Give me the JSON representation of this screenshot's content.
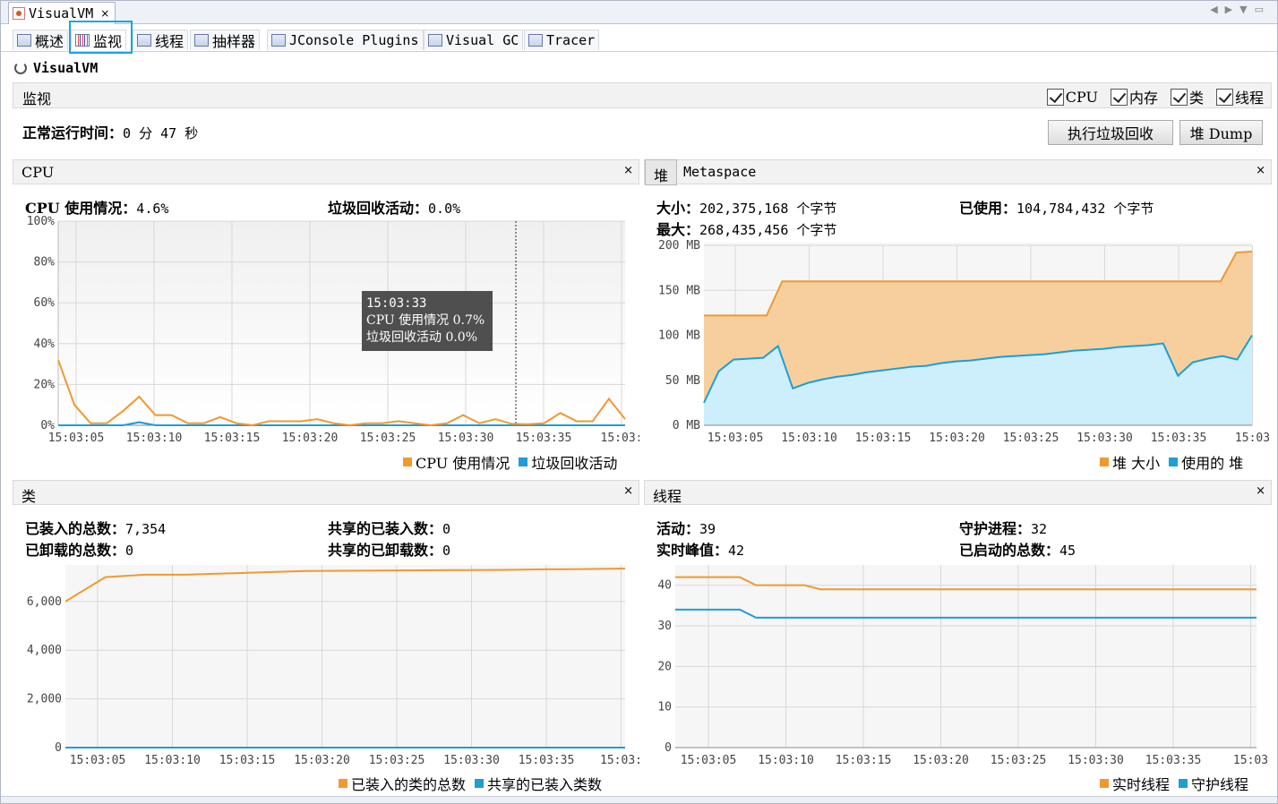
{
  "app": {
    "doc_tab_title": "VisualVM",
    "close_glyph": "×",
    "heading": "VisualVM"
  },
  "tabs": [
    {
      "label": "概述",
      "icon": "overview-icon"
    },
    {
      "label": "监视",
      "icon": "monitor-icon"
    },
    {
      "label": "线程",
      "icon": "threads-icon"
    },
    {
      "label": "抽样器",
      "icon": "sampler-icon"
    },
    {
      "label": "JConsole Plugins",
      "icon": "jconsole-icon"
    },
    {
      "label": "Visual GC",
      "icon": "visualgc-icon"
    },
    {
      "label": "Tracer",
      "icon": "tracer-icon"
    }
  ],
  "monitor": {
    "title": "监视",
    "checks": [
      "CPU",
      "内存",
      "类",
      "线程"
    ],
    "uptime_label": "正常运行时间：",
    "uptime_value": "0 分 47 秒",
    "gc_button": "执行垃圾回收",
    "heap_dump_button": "堆 Dump"
  },
  "colors": {
    "orange": "#f0992f",
    "blue": "#1e9dd6",
    "heap_fill": "#f7cf9d",
    "used_fill": "#cdeefb"
  },
  "cpu_panel": {
    "title": "CPU",
    "usage_label": "CPU 使用情况：",
    "usage_value": "4.6%",
    "gc_label": "垃圾回收活动：",
    "gc_value": "0.0%",
    "tooltip": {
      "time": "15:03:33",
      "line1": "CPU 使用情况 0.7%",
      "line2": "垃圾回收活动 0.0%"
    },
    "legend": [
      "CPU 使用情况",
      "垃圾回收活动"
    ]
  },
  "heap_panel": {
    "tab_label": "堆",
    "title": "Metaspace",
    "size_label": "大小：",
    "size_value": "202,375,168 个字节",
    "used_label": "已使用：",
    "used_value": "104,784,432 个字节",
    "max_label": "最大：",
    "max_value": "268,435,456 个字节",
    "legend": [
      "堆 大小",
      "使用的 堆"
    ]
  },
  "classes_panel": {
    "title": "类",
    "loaded_label": "已装入的总数：",
    "loaded_value": "7,354",
    "unloaded_label": "已卸载的总数：",
    "unloaded_value": "0",
    "shared_loaded_label": "共享的已装入数：",
    "shared_loaded_value": "0",
    "shared_unloaded_label": "共享的已卸载数：",
    "shared_unloaded_value": "0",
    "legend": [
      "已装入的类的总数",
      "共享的已装入类数"
    ]
  },
  "threads_panel": {
    "title": "线程",
    "live_label": "活动：",
    "live_value": "39",
    "daemon_label": "守护进程：",
    "daemon_value": "32",
    "peak_label": "实时峰值：",
    "peak_value": "42",
    "started_label": "已启动的总数：",
    "started_value": "45",
    "legend": [
      "实时线程",
      "守护线程"
    ]
  },
  "chart_data": [
    {
      "type": "line",
      "title": "CPU",
      "x": [
        "15:03:05",
        "15:03:06",
        "15:03:07",
        "15:03:08",
        "15:03:09",
        "15:03:10",
        "15:03:11",
        "15:03:12",
        "15:03:13",
        "15:03:14",
        "15:03:15",
        "15:03:16",
        "15:03:17",
        "15:03:18",
        "15:03:19",
        "15:03:20",
        "15:03:21",
        "15:03:22",
        "15:03:23",
        "15:03:24",
        "15:03:25",
        "15:03:26",
        "15:03:27",
        "15:03:28",
        "15:03:29",
        "15:03:30",
        "15:03:31",
        "15:03:32",
        "15:03:33",
        "15:03:34",
        "15:03:35",
        "15:03:36",
        "15:03:37",
        "15:03:38",
        "15:03:39"
      ],
      "xticks": [
        "15:03:05",
        "15:03:10",
        "15:03:15",
        "15:03:20",
        "15:03:25",
        "15:03:30",
        "15:03:35",
        "15:03:"
      ],
      "ylim": [
        0,
        100
      ],
      "yticks": [
        "0%",
        "20%",
        "40%",
        "60%",
        "80%",
        "100%"
      ],
      "series": [
        {
          "name": "CPU 使用情况",
          "values": [
            32,
            10,
            1,
            1,
            7,
            14,
            5,
            5,
            1,
            1,
            4,
            1,
            0,
            2,
            2,
            2,
            3,
            1,
            0,
            1,
            1,
            2,
            1,
            0,
            1,
            5,
            1,
            3,
            0.7,
            0.5,
            1,
            6,
            2,
            2,
            13,
            3
          ]
        },
        {
          "name": "垃圾回收活动",
          "values": [
            0,
            0,
            0,
            0,
            0,
            1.5,
            0,
            0,
            0,
            0,
            0,
            0,
            0,
            0,
            0,
            0,
            0,
            0,
            0,
            0,
            0,
            0,
            0,
            0,
            0,
            0,
            0,
            0,
            0,
            0,
            0,
            0,
            0,
            0,
            0,
            0
          ]
        }
      ]
    },
    {
      "type": "area",
      "title": "Metaspace",
      "x": [
        "15:03:05",
        "15:03:06",
        "15:03:07",
        "15:03:08",
        "15:03:09",
        "15:03:10",
        "15:03:11",
        "15:03:12",
        "15:03:13",
        "15:03:14",
        "15:03:15",
        "15:03:16",
        "15:03:17",
        "15:03:18",
        "15:03:19",
        "15:03:20",
        "15:03:21",
        "15:03:22",
        "15:03:23",
        "15:03:24",
        "15:03:25",
        "15:03:26",
        "15:03:27",
        "15:03:28",
        "15:03:29",
        "15:03:30",
        "15:03:31",
        "15:03:32",
        "15:03:33",
        "15:03:34",
        "15:03:35",
        "15:03:36",
        "15:03:37",
        "15:03:38",
        "15:03:39"
      ],
      "xticks": [
        "15:03:05",
        "15:03:10",
        "15:03:15",
        "15:03:20",
        "15:03:25",
        "15:03:30",
        "15:03:35",
        "15:03"
      ],
      "ylim": [
        0,
        200
      ],
      "yticks": [
        "0 MB",
        "50 MB",
        "100 MB",
        "150 MB",
        "200 MB"
      ],
      "series": [
        {
          "name": "堆 大小",
          "values": [
            122,
            122,
            122,
            122,
            122,
            160,
            160,
            160,
            160,
            160,
            160,
            160,
            160,
            160,
            160,
            160,
            160,
            160,
            160,
            160,
            160,
            160,
            160,
            160,
            160,
            160,
            160,
            160,
            160,
            160,
            160,
            160,
            160,
            160,
            192,
            193
          ]
        },
        {
          "name": "使用的 堆",
          "values": [
            25,
            60,
            73,
            74,
            75,
            88,
            41,
            47,
            51,
            54,
            56,
            59,
            61,
            63,
            65,
            66,
            69,
            71,
            72,
            74,
            76,
            77,
            78,
            79,
            81,
            83,
            84,
            85,
            87,
            88,
            89,
            91,
            55,
            70,
            74,
            77,
            73,
            100
          ]
        }
      ]
    },
    {
      "type": "line",
      "title": "类",
      "x": [
        "15:03:05",
        "15:03:10",
        "15:03:15",
        "15:03:20",
        "15:03:25",
        "15:03:30",
        "15:03:35",
        "15:03:"
      ],
      "xticks": [
        "15:03:05",
        "15:03:10",
        "15:03:15",
        "15:03:20",
        "15:03:25",
        "15:03:30",
        "15:03:35",
        "15:03:"
      ],
      "ylim": [
        0,
        7500
      ],
      "yticks": [
        "0",
        "2,000",
        "4,000",
        "6,000"
      ],
      "series": [
        {
          "name": "已装入的类的总数",
          "values": [
            6000,
            7000,
            7100,
            7100,
            7150,
            7200,
            7250,
            7260,
            7270,
            7280,
            7290,
            7300,
            7320,
            7330,
            7354
          ]
        },
        {
          "name": "共享的已装入类数",
          "values": [
            0,
            0,
            0,
            0,
            0,
            0,
            0,
            0,
            0,
            0,
            0,
            0,
            0,
            0,
            0
          ]
        }
      ]
    },
    {
      "type": "line",
      "title": "线程",
      "x": [
        "15:03:05",
        "15:03:10",
        "15:03:15",
        "15:03:20",
        "15:03:25",
        "15:03:30",
        "15:03:35",
        "15:03"
      ],
      "xticks": [
        "15:03:05",
        "15:03:10",
        "15:03:15",
        "15:03:20",
        "15:03:25",
        "15:03:30",
        "15:03:35",
        "15:03"
      ],
      "ylim": [
        0,
        45
      ],
      "yticks": [
        "0",
        "10",
        "20",
        "30",
        "40"
      ],
      "series": [
        {
          "name": "实时线程",
          "values": [
            42,
            42,
            42,
            42,
            42,
            40,
            40,
            40,
            40,
            39,
            39,
            39,
            39,
            39,
            39,
            39,
            39,
            39,
            39,
            39,
            39,
            39,
            39,
            39,
            39,
            39,
            39,
            39,
            39,
            39,
            39,
            39,
            39,
            39,
            39,
            39,
            39
          ]
        },
        {
          "name": "守护线程",
          "values": [
            34,
            34,
            34,
            34,
            34,
            32,
            32,
            32,
            32,
            32,
            32,
            32,
            32,
            32,
            32,
            32,
            32,
            32,
            32,
            32,
            32,
            32,
            32,
            32,
            32,
            32,
            32,
            32,
            32,
            32,
            32,
            32,
            32,
            32,
            32,
            32,
            32
          ]
        }
      ]
    }
  ]
}
